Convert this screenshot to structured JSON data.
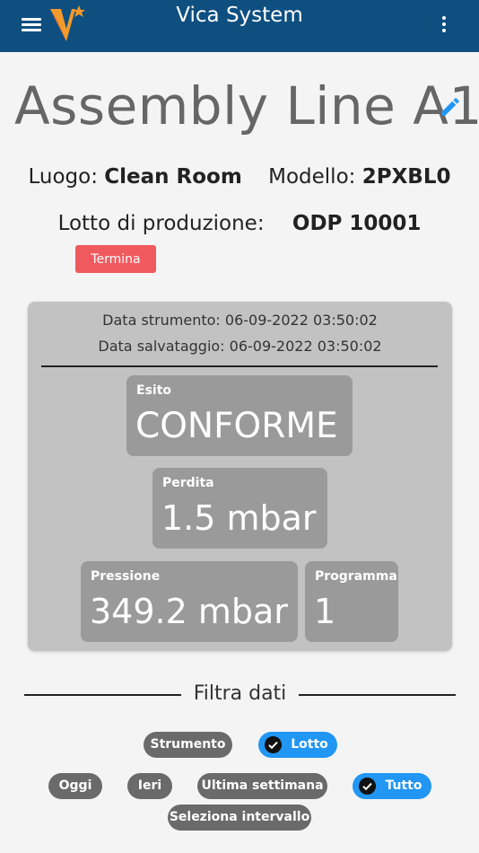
{
  "app": {
    "title": "Vica System",
    "brand_color": "#0e4f80"
  },
  "page": {
    "title": "Assembly Line A1",
    "location_label": "Luogo:",
    "location_value": "Clean Room",
    "model_label": "Modello:",
    "model_value": "2PXBL0",
    "lot_label": "Lotto di produzione:",
    "lot_value": "ODP 10001",
    "stop_button": "Termina"
  },
  "measurement": {
    "instrument_date": "Data strumento: 06-09-2022 03:50:02",
    "saved_date": "Data salvataggio: 06-09-2022 03:50:02",
    "result_label": "Esito",
    "result_value": "CONFORME",
    "leak_label": "Perdita",
    "leak_value": "1.5 mbar",
    "pressure_label": "Pressione",
    "pressure_value": "349.2 mbar",
    "program_label": "Programma",
    "program_value": "1"
  },
  "filter": {
    "title": "Filtra dati",
    "chips": {
      "instrument": "Strumento",
      "lot": "Lotto",
      "today": "Oggi",
      "yesterday": "Ieri",
      "last_week": "Ultima settimana",
      "all": "Tutto",
      "select_range": "Seleziona intervallo"
    },
    "active_color": "#2196f3",
    "inactive_color": "#6a6a6a"
  }
}
